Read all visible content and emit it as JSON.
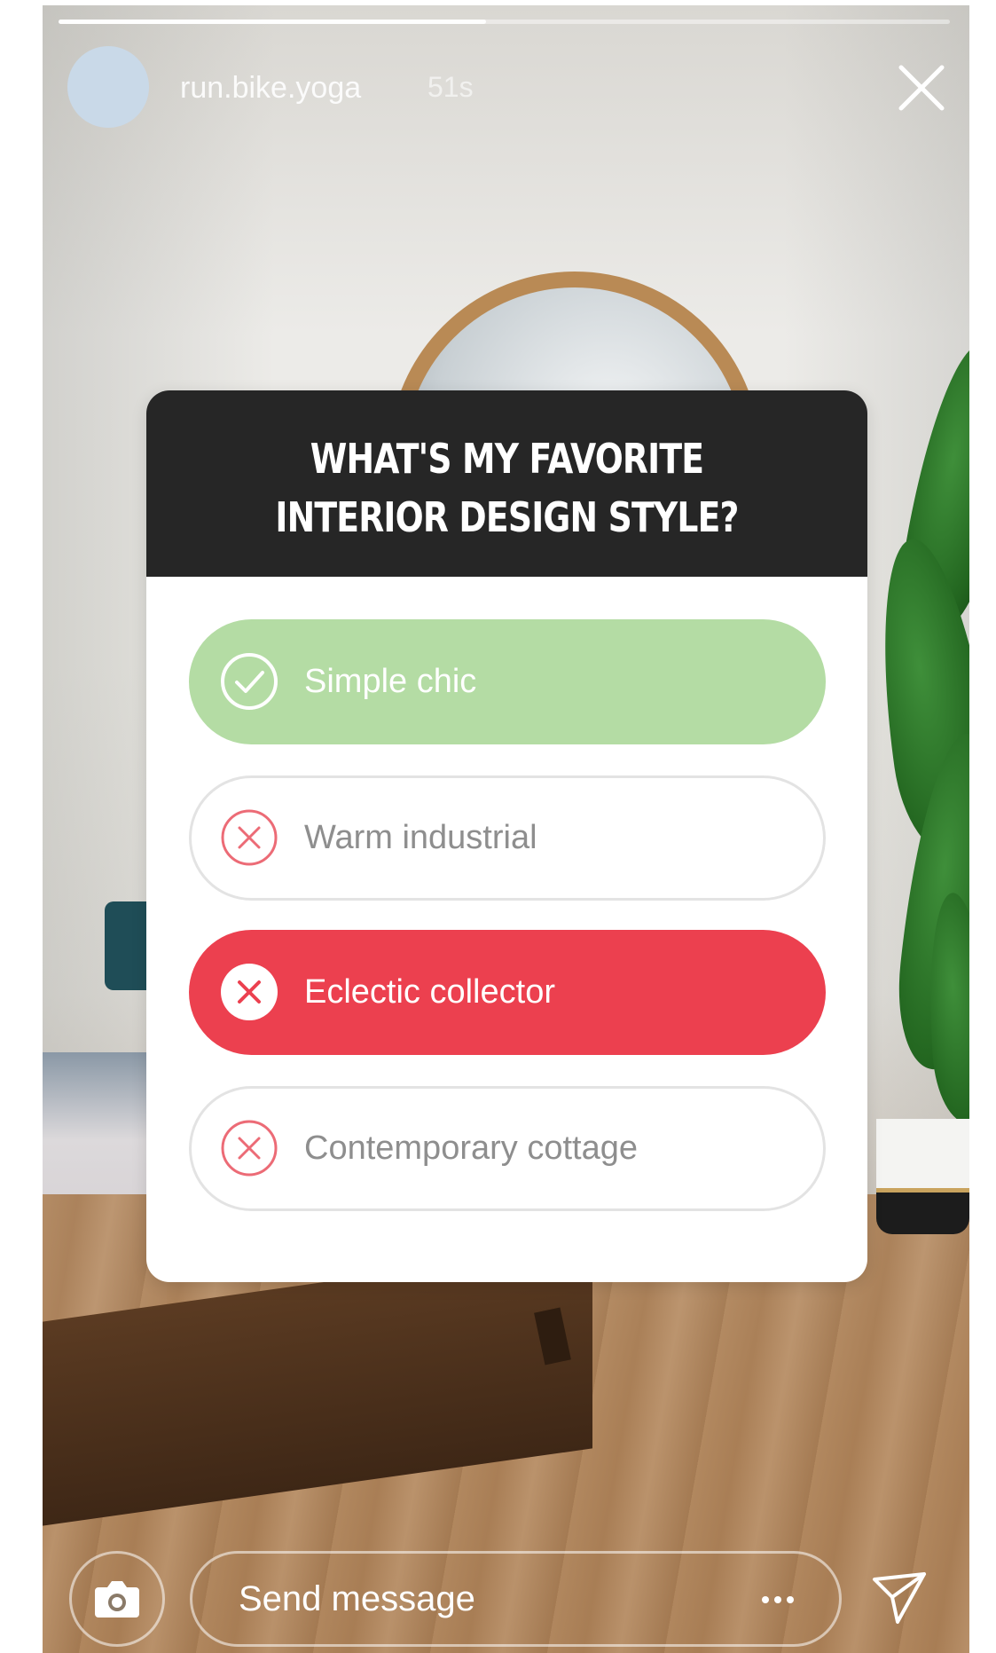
{
  "story": {
    "progress_fraction": 0.48,
    "username": "run.bike.yoga",
    "timestamp": "51s",
    "close_icon": "close-icon"
  },
  "poll": {
    "question": "WHAT'S MY FAVORITE INTERIOR DESIGN STYLE?",
    "options": [
      {
        "label": "Simple chic",
        "state": "correct",
        "icon": "check-circle-icon",
        "color": "#b4dca4"
      },
      {
        "label": "Warm industrial",
        "state": "unselected",
        "icon": "x-circle-icon",
        "color": "#ffffff"
      },
      {
        "label": "Eclectic collector",
        "state": "selected-wrong",
        "icon": "x-circle-icon",
        "color": "#ec404f"
      },
      {
        "label": "Contemporary cottage",
        "state": "unselected",
        "icon": "x-circle-icon",
        "color": "#ffffff"
      }
    ]
  },
  "footer": {
    "camera_icon": "camera-icon",
    "message_placeholder": "Send message",
    "more_icon": "more-dots-icon",
    "send_icon": "send-icon"
  },
  "colors": {
    "header_bg": "#262626",
    "correct": "#b4dca4",
    "wrong": "#ec404f",
    "wrong_icon": "#ec6b76"
  }
}
